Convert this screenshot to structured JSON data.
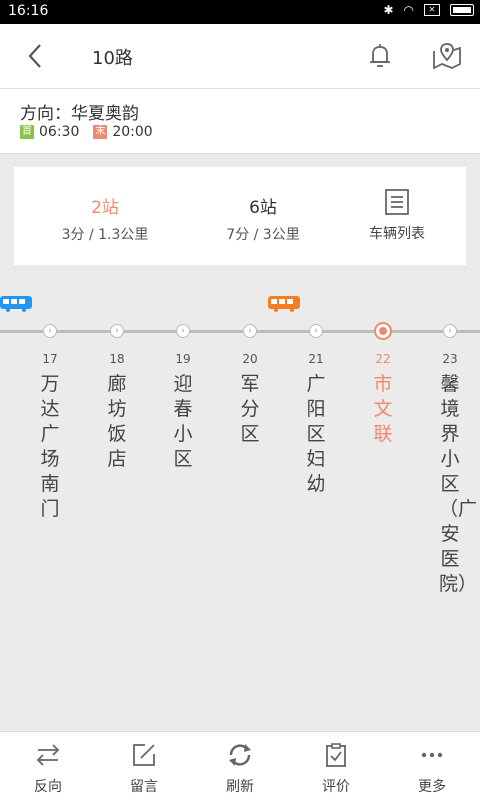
{
  "status": {
    "time": "16:16",
    "sim_label": "✕"
  },
  "header": {
    "title": "10路"
  },
  "info": {
    "direction": "方向：华夏奥韵",
    "first_tag": "首",
    "first_time": "06:30",
    "last_tag": "末",
    "last_time": "20:00"
  },
  "summary": {
    "near_stops": "2站",
    "near_detail": "3分 / 1.3公里",
    "far_stops": "6站",
    "far_detail": "7分 / 3公里",
    "vehicle_list": "车辆列表"
  },
  "stops": [
    {
      "num": "17",
      "name": "万达广场南门"
    },
    {
      "num": "18",
      "name": "廊坊饭店"
    },
    {
      "num": "19",
      "name": "迎春小区"
    },
    {
      "num": "20",
      "name": "军分区"
    },
    {
      "num": "21",
      "name": "广阳区妇幼"
    },
    {
      "num": "22",
      "name": "市文联"
    },
    {
      "num": "23",
      "name": "馨境界小区（广安医院）"
    }
  ],
  "current_stop_index": 5,
  "tabs": [
    {
      "label": "反向",
      "icon": "swap-icon"
    },
    {
      "label": "留言",
      "icon": "edit-icon"
    },
    {
      "label": "刷新",
      "icon": "refresh-icon"
    },
    {
      "label": "评价",
      "icon": "clipboard-icon"
    },
    {
      "label": "更多",
      "icon": "more-icon"
    }
  ],
  "colors": {
    "accent": "#f08a6e",
    "bus_blue": "#2196f3",
    "bus_orange": "#f57c1f",
    "tag_green": "#8bc34a"
  }
}
